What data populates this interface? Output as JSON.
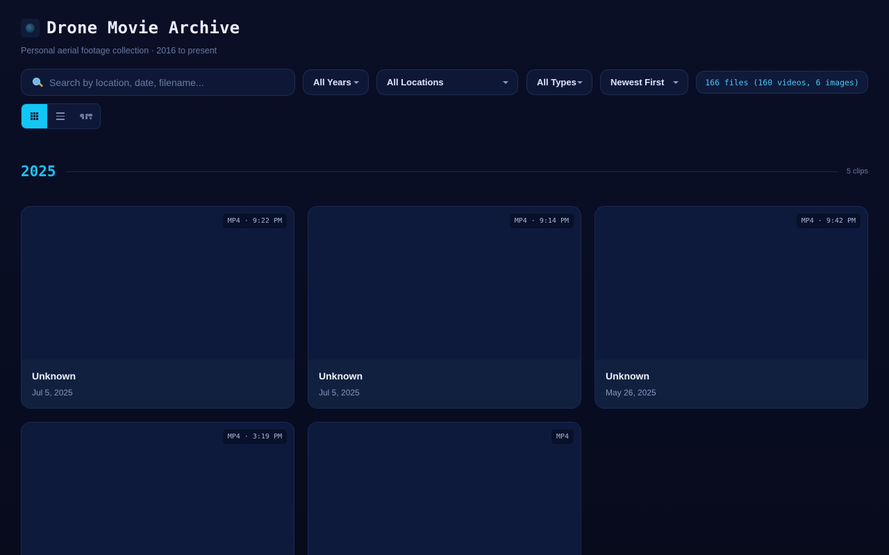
{
  "header": {
    "title": "Drone Movie Archive",
    "subtitle": "Personal aerial footage collection · 2016 to present"
  },
  "search": {
    "placeholder": "Search by location, date, filename...",
    "value": ""
  },
  "filters": {
    "year": "All Years",
    "location": "All Locations",
    "type": "All Types",
    "sort": "Newest First"
  },
  "summary": "166 files (160 videos, 6 images)",
  "views": [
    "grid",
    "list",
    "map"
  ],
  "active_view": "grid",
  "group": {
    "year": "2025",
    "count": "5 clips"
  },
  "cards": [
    {
      "badge": "MP4 · 9:22 PM",
      "title": "Unknown",
      "date": "Jul 5, 2025"
    },
    {
      "badge": "MP4 · 9:14 PM",
      "title": "Unknown",
      "date": "Jul 5, 2025"
    },
    {
      "badge": "MP4 · 9:42 PM",
      "title": "Unknown",
      "date": "May 26, 2025"
    },
    {
      "badge": "MP4 · 3:19 PM",
      "title": "",
      "date": ""
    },
    {
      "badge": "MP4",
      "title": "",
      "date": ""
    }
  ],
  "colors": {
    "accent": "#12c6f6",
    "background": "#0a0f26",
    "card": "#0f1a3c"
  }
}
